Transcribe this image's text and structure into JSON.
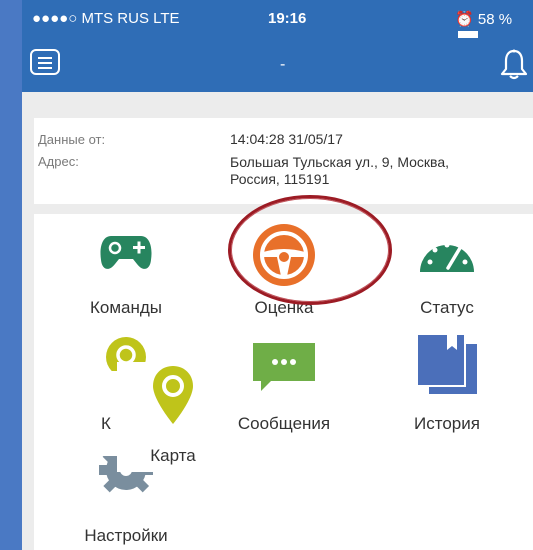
{
  "status_bar": {
    "carrier": "●●●●○ MTS RUS  LTE",
    "time": "19:16",
    "battery": "58 %"
  },
  "nav": {
    "title": "-",
    "icons": [
      "menu-icon",
      "bell-icon"
    ]
  },
  "info": {
    "data_label": "Данные от:",
    "data_value": "14:04:28 31/05/17",
    "address_label": "Адрес:",
    "address_line1": "Большая Тульская ул., 9, Москва,",
    "address_line2": "Россия, 115191"
  },
  "menu": {
    "commands": "Команды",
    "rating": "Оценка",
    "status": "Статус",
    "map_partial": "К",
    "messages": "Сообщения",
    "history": "История",
    "map": "Карта",
    "settings": "Настройки"
  },
  "colors": {
    "nav_bg": "#2f6db6",
    "green": "#27855f",
    "orange": "#e8702a",
    "yellow_green": "#bfc41a",
    "light_green": "#6fae47",
    "blue": "#4b6fba",
    "gray": "#7a8e9e",
    "highlight_circle": "#9c1b24"
  }
}
